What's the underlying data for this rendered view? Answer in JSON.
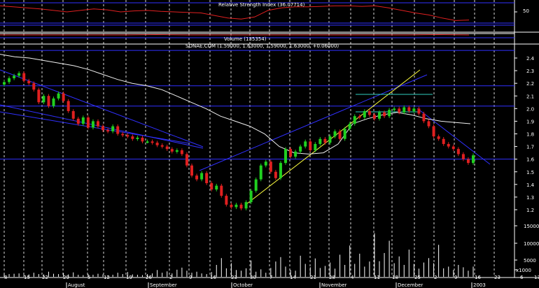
{
  "chart_data": [
    {
      "type": "line",
      "title": "Relative Strength Index (36.07714)",
      "y_ticks": [
        50
      ],
      "series": [
        {
          "name": "Relative Strength Index",
          "values": [
            64,
            62,
            60,
            58,
            55,
            52,
            55,
            58,
            56,
            52,
            54,
            55,
            53,
            52,
            51,
            50,
            45,
            40,
            38,
            42,
            55,
            60,
            62,
            62,
            63,
            64,
            64,
            63,
            64,
            60,
            55,
            50,
            46,
            40,
            35,
            36
          ]
        }
      ]
    },
    {
      "type": "line",
      "title": "Volume (135354)",
      "series": [
        {
          "name": "Volume",
          "values": [
            2,
            2,
            2,
            2,
            2,
            3,
            2,
            2,
            2,
            2,
            2,
            2,
            2,
            2,
            3,
            2
          ]
        }
      ]
    },
    {
      "type": "candlestick",
      "title": "SONAE.COM (1.59000, 1.63000, 1.59000, 1.63000, +0.06000)",
      "ylim": [
        1.1,
        2.45
      ],
      "y_ticks": [
        1.2,
        1.3,
        1.4,
        1.5,
        1.6,
        1.7,
        1.8,
        1.9,
        2.0,
        2.1,
        2.2,
        2.3,
        2.4
      ],
      "closes": [
        2.21,
        2.24,
        2.26,
        2.28,
        2.22,
        2.2,
        2.15,
        2.05,
        2.1,
        2.02,
        2.08,
        2.12,
        2.06,
        1.98,
        1.92,
        1.88,
        1.93,
        1.85,
        1.9,
        1.86,
        1.83,
        1.82,
        1.86,
        1.8,
        1.79,
        1.78,
        1.76,
        1.77,
        1.74,
        1.74,
        1.73,
        1.71,
        1.7,
        1.68,
        1.66,
        1.67,
        1.64,
        1.55,
        1.47,
        1.44,
        1.49,
        1.41,
        1.36,
        1.39,
        1.31,
        1.24,
        1.22,
        1.24,
        1.21,
        1.26,
        1.35,
        1.44,
        1.55,
        1.58,
        1.5,
        1.45,
        1.57,
        1.68,
        1.62,
        1.66,
        1.7,
        1.74,
        1.67,
        1.72,
        1.76,
        1.73,
        1.78,
        1.82,
        1.76,
        1.84,
        1.88,
        1.94,
        1.93,
        1.98,
        1.95,
        1.92,
        1.97,
        1.94,
        1.99,
        2.0,
        1.97,
        2.01,
        1.98,
        2.0,
        1.96,
        1.9,
        1.86,
        1.78,
        1.76,
        1.72,
        1.7,
        1.68,
        1.64,
        1.6,
        1.57,
        1.63
      ],
      "moving_average": [
        2.43,
        2.41,
        2.4,
        2.38,
        2.36,
        2.34,
        2.31,
        2.27,
        2.23,
        2.2,
        2.18,
        2.15,
        2.1,
        2.05,
        2.0,
        1.94,
        1.9,
        1.86,
        1.8,
        1.7,
        1.65,
        1.64,
        1.65,
        1.72,
        1.88,
        1.92,
        1.95,
        1.97,
        1.95,
        1.92,
        1.9,
        1.89,
        1.88
      ],
      "hlines": [
        2.46,
        2.18,
        2.02,
        1.6
      ],
      "x_tick_labels": [
        "8",
        "15",
        "22",
        "29",
        "5",
        "12",
        "19",
        "26",
        "2",
        "9",
        "16",
        "23",
        "30",
        "7",
        "14",
        "21",
        "28",
        "4",
        "11",
        "18",
        "25",
        "2",
        "9",
        "16",
        "23",
        "6",
        "13"
      ],
      "months": [
        "August",
        "September",
        "October",
        "November",
        "December",
        "2003"
      ]
    },
    {
      "type": "bar",
      "title": "Volume",
      "y_ticks": [
        "15000",
        "10000",
        "5000",
        "x1000"
      ],
      "values": [
        900,
        800,
        900,
        1000,
        600,
        700,
        1200,
        800,
        700,
        1500,
        900,
        800,
        1100,
        700,
        1300,
        600,
        500,
        800,
        600,
        900,
        700,
        400,
        600,
        1200,
        800,
        1400,
        700,
        600,
        500,
        800,
        1000,
        2000,
        1200,
        1600,
        1000,
        2100,
        2700,
        1800,
        1200,
        1500,
        1000,
        800,
        1400,
        3500,
        5500,
        2500,
        4000,
        2000,
        1800,
        2500,
        4800,
        1500,
        2200,
        1200,
        2600,
        4500,
        5800,
        3000,
        2000,
        1800,
        6200,
        3800,
        2800,
        5400,
        2600,
        3200,
        4200,
        2400,
        6500,
        3500,
        9200,
        3800,
        6800,
        3000,
        4500,
        12800,
        4600,
        7000,
        10600,
        4000,
        6000,
        3500,
        8000,
        3800,
        2400,
        4200,
        5500,
        4000,
        9400,
        2500,
        3000,
        2000,
        3500,
        2800,
        1800,
        3000
      ]
    }
  ]
}
